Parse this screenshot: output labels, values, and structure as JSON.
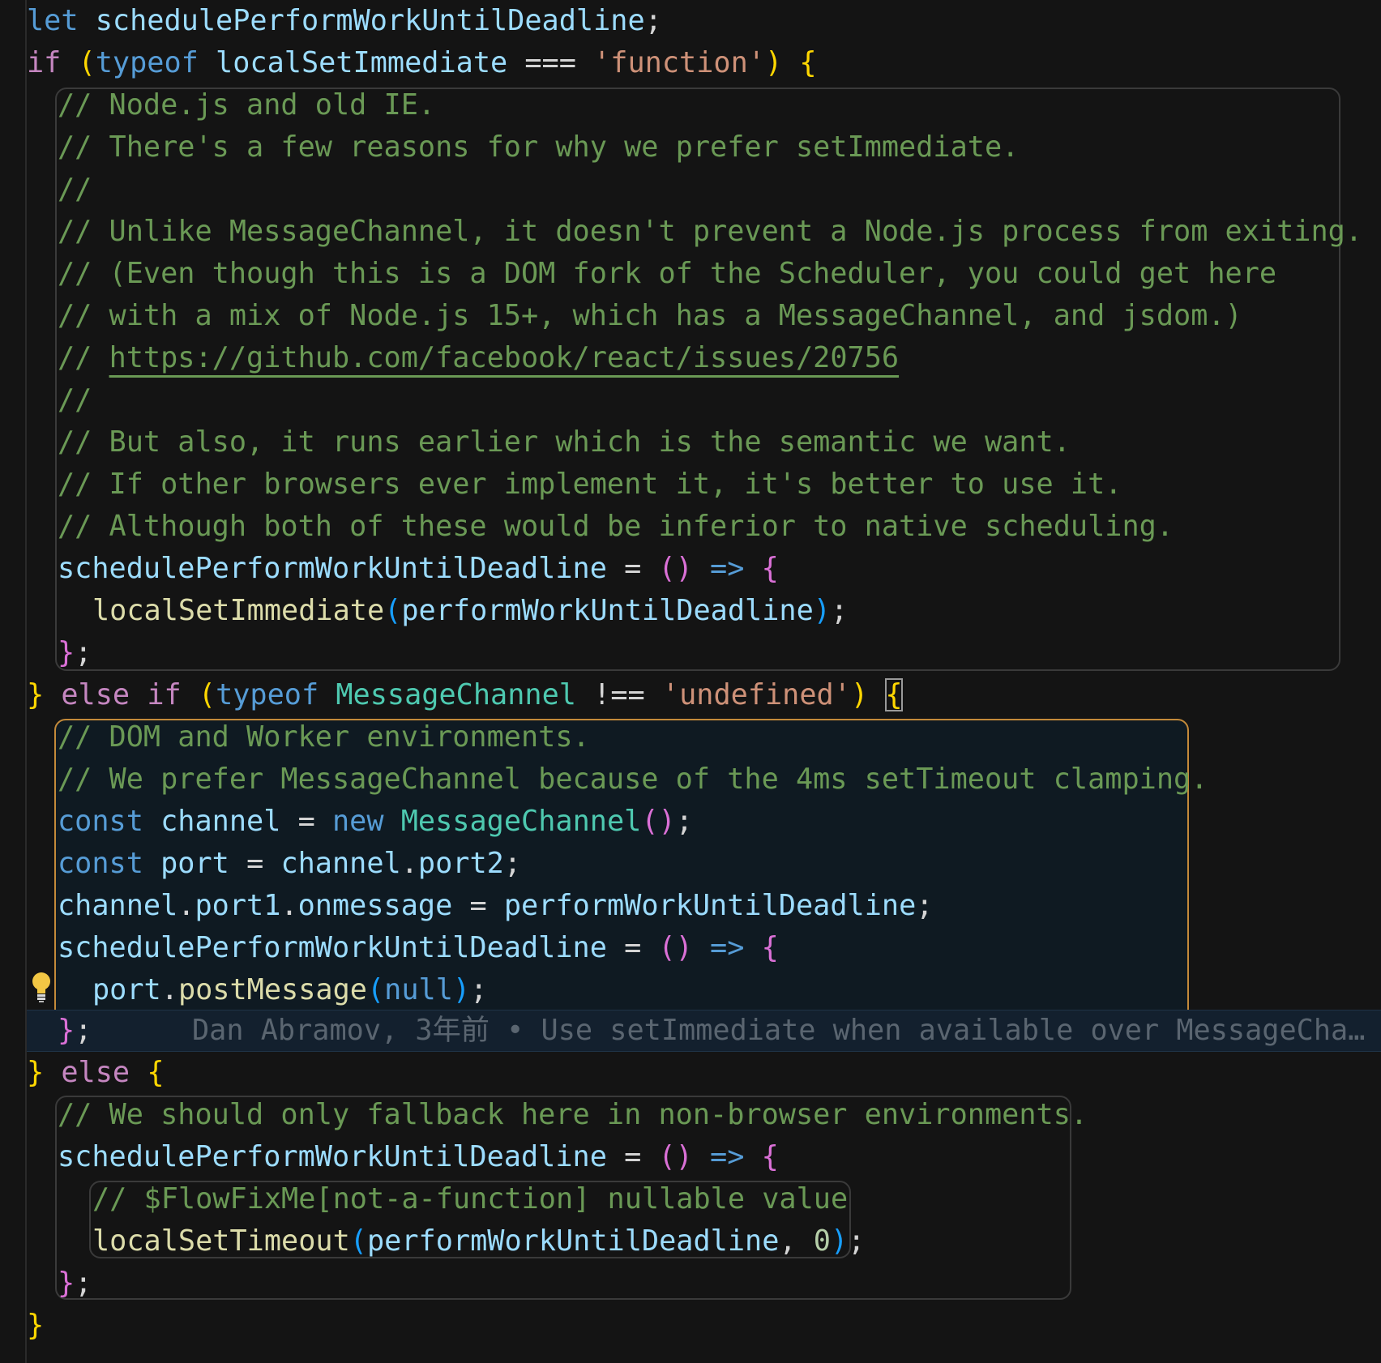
{
  "editor": {
    "blame": {
      "author": "Dan Abramov,",
      "when": "3年前",
      "separator": "•",
      "message": "Use setImmediate when available over MessageCha…"
    }
  },
  "code": {
    "l1": [
      "let",
      "schedulePerformWorkUntilDeadline",
      ";"
    ],
    "l2": [
      "if",
      "(",
      "typeof",
      "localSetImmediate",
      "===",
      "'function'",
      ")",
      "{"
    ],
    "c1": "// Node.js and old IE.",
    "c2": "// There's a few reasons for why we prefer setImmediate.",
    "c3": "//",
    "c4": "// Unlike MessageChannel, it doesn't prevent a Node.js process from exiting.",
    "c5": "// (Even though this is a DOM fork of the Scheduler, you could get here",
    "c6": "// with a mix of Node.js 15+, which has a MessageChannel, and jsdom.)",
    "c7_prefix": "// ",
    "c7_link": "https://github.com/facebook/react/issues/20756",
    "c8": "//",
    "c9": "// But also, it runs earlier which is the semantic we want.",
    "c10": "// If other browsers ever implement it, it's better to use it.",
    "c11": "// Although both of these would be inferior to native scheduling.",
    "l14": [
      "schedulePerformWorkUntilDeadline",
      "=",
      "()",
      "=>",
      "{"
    ],
    "l15": [
      "localSetImmediate",
      "(",
      "performWorkUntilDeadline",
      ")",
      ";"
    ],
    "l16": [
      "}",
      ";"
    ],
    "l17": [
      "}",
      "else",
      "if",
      "(",
      "typeof",
      "MessageChannel",
      "!==",
      "'undefined'",
      ")",
      "{"
    ],
    "c12": "// DOM and Worker environments.",
    "c13": "// We prefer MessageChannel because of the 4ms setTimeout clamping.",
    "l20": [
      "const",
      "channel",
      "=",
      "new",
      "MessageChannel",
      "()",
      ";"
    ],
    "l21": [
      "const",
      "port",
      "=",
      "channel",
      ".",
      "port2",
      ";"
    ],
    "l22": [
      "channel",
      ".",
      "port1",
      ".",
      "onmessage",
      "=",
      "performWorkUntilDeadline",
      ";"
    ],
    "l23": [
      "schedulePerformWorkUntilDeadline",
      "=",
      "()",
      "=>",
      "{"
    ],
    "l24": [
      "port",
      ".",
      "postMessage",
      "(",
      "null",
      ")",
      ";"
    ],
    "l25": [
      "}",
      ";"
    ],
    "l26": [
      "}",
      "else",
      "{"
    ],
    "c14": "// We should only fallback here in non-browser environments.",
    "l28": [
      "schedulePerformWorkUntilDeadline",
      "=",
      "()",
      "=>",
      "{"
    ],
    "c15": "// $FlowFixMe[not-a-function] nullable value",
    "l30": [
      "localSetTimeout",
      "(",
      "performWorkUntilDeadline",
      ",",
      "0",
      ")",
      ";"
    ],
    "l31": [
      "}",
      ";"
    ],
    "l32": [
      "}"
    ]
  },
  "icons": {
    "lightbulb": "lightbulb-icon"
  },
  "colors": {
    "background": "#141414",
    "keyword": "#569cd6",
    "control": "#c586c0",
    "variable": "#9cdcfe",
    "function": "#dcdcaa",
    "class": "#4ec9b0",
    "string": "#ce9178",
    "comment": "#6a9955",
    "bracket_gold": "#ffd700",
    "bracket_pink": "#da70d6",
    "bracket_blue": "#179fff",
    "active_scope_border": "#c48a3a"
  }
}
